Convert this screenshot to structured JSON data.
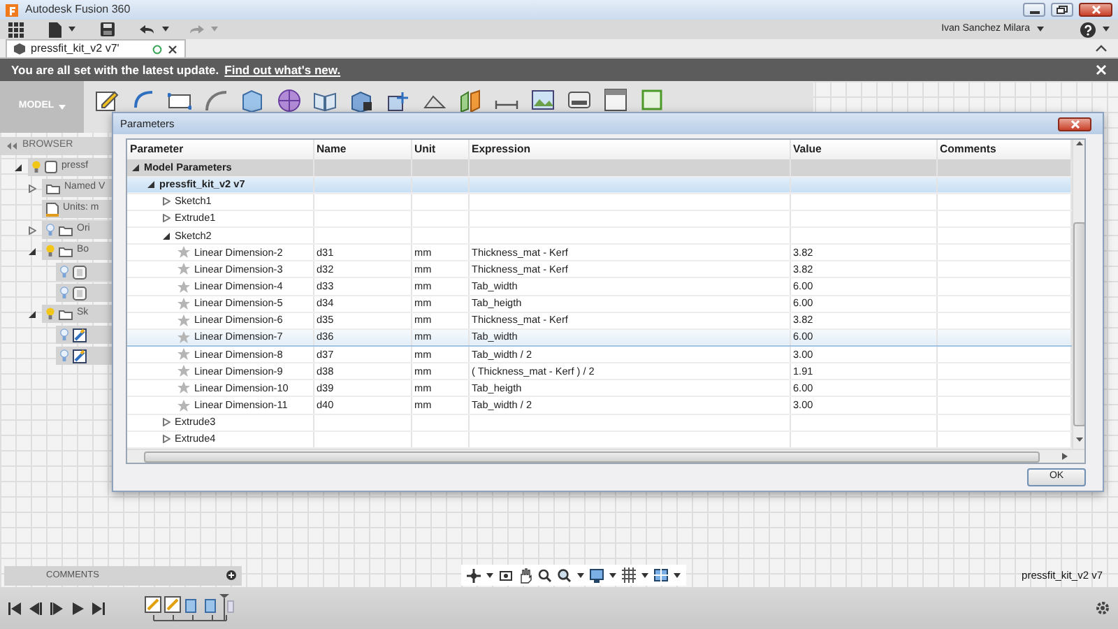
{
  "window": {
    "title": "Autodesk Fusion 360"
  },
  "toolbar": {
    "user": "Ivan Sanchez Milara"
  },
  "document_tab": {
    "title": "pressfit_kit_v2 v7'"
  },
  "banner": {
    "text": "You are all set with the latest update.",
    "link": "Find out what's new."
  },
  "ribbon": {
    "workspace": "MODEL"
  },
  "browser": {
    "title": "BROWSER",
    "items": [
      {
        "label": "pressf",
        "kind": "component",
        "expanded": true,
        "visible": true,
        "children": [
          {
            "label": "Named V",
            "kind": "folder",
            "expanded": false
          },
          {
            "label": "Units: m",
            "kind": "units"
          },
          {
            "label": "Ori",
            "kind": "folder",
            "expanded": false,
            "visible": false
          },
          {
            "label": "Bo",
            "kind": "folder",
            "expanded": true,
            "visible": true,
            "children": [
              {
                "kind": "body",
                "visible": false
              },
              {
                "kind": "body",
                "visible": false
              }
            ]
          },
          {
            "label": "Sk",
            "kind": "folder",
            "expanded": true,
            "visible": true,
            "children": [
              {
                "kind": "sketch",
                "visible": false
              },
              {
                "kind": "sketch",
                "visible": false
              }
            ]
          }
        ]
      }
    ]
  },
  "dialog": {
    "title": "Parameters",
    "columns": [
      "Parameter",
      "Name",
      "Unit",
      "Expression",
      "Value",
      "Comments"
    ],
    "rows": [
      {
        "label": "Model Parameters",
        "kind": "group",
        "expanded": true,
        "selected": false,
        "children": [
          {
            "label": "pressfit_kit_v2 v7",
            "kind": "component",
            "expanded": true,
            "selected": false,
            "children": [
              {
                "label": "Sketch1",
                "kind": "feature",
                "expanded": false,
                "selected": false
              },
              {
                "label": "Extrude1",
                "kind": "feature",
                "expanded": false,
                "selected": false
              },
              {
                "label": "Sketch2",
                "kind": "feature",
                "expanded": true,
                "selected": false,
                "children": [
                  {
                    "label": "Linear Dimension-2",
                    "kind": "parameter",
                    "name": "d31",
                    "unit": "mm",
                    "expression": "Thickness_mat - Kerf",
                    "value": "3.82",
                    "selected": false
                  },
                  {
                    "label": "Linear Dimension-3",
                    "kind": "parameter",
                    "name": "d32",
                    "unit": "mm",
                    "expression": "Thickness_mat - Kerf",
                    "value": "3.82",
                    "selected": false
                  },
                  {
                    "label": "Linear Dimension-4",
                    "kind": "parameter",
                    "name": "d33",
                    "unit": "mm",
                    "expression": "Tab_width",
                    "value": "6.00",
                    "selected": false
                  },
                  {
                    "label": "Linear Dimension-5",
                    "kind": "parameter",
                    "name": "d34",
                    "unit": "mm",
                    "expression": "Tab_heigth",
                    "value": "6.00",
                    "selected": false
                  },
                  {
                    "label": "Linear Dimension-6",
                    "kind": "parameter",
                    "name": "d35",
                    "unit": "mm",
                    "expression": "Thickness_mat - Kerf",
                    "value": "3.82",
                    "selected": false
                  },
                  {
                    "label": "Linear Dimension-7",
                    "kind": "parameter",
                    "name": "d36",
                    "unit": "mm",
                    "expression": "Tab_width",
                    "value": "6.00",
                    "selected": true
                  },
                  {
                    "label": "Linear Dimension-8",
                    "kind": "parameter",
                    "name": "d37",
                    "unit": "mm",
                    "expression": "Tab_width / 2",
                    "value": "3.00",
                    "selected": false
                  },
                  {
                    "label": "Linear Dimension-9",
                    "kind": "parameter",
                    "name": "d38",
                    "unit": "mm",
                    "expression": "( Thickness_mat - Kerf ) / 2",
                    "value": "1.91",
                    "selected": false
                  },
                  {
                    "label": "Linear Dimension-10",
                    "kind": "parameter",
                    "name": "d39",
                    "unit": "mm",
                    "expression": "Tab_heigth",
                    "value": "6.00",
                    "selected": false
                  },
                  {
                    "label": "Linear Dimension-11",
                    "kind": "parameter",
                    "name": "d40",
                    "unit": "mm",
                    "expression": "Tab_width / 2",
                    "value": "3.00",
                    "selected": false
                  }
                ]
              },
              {
                "label": "Extrude3",
                "kind": "feature",
                "expanded": false,
                "selected": false
              },
              {
                "label": "Extrude4",
                "kind": "feature",
                "expanded": false,
                "selected": false
              }
            ]
          }
        ]
      }
    ],
    "ok_button": "OK"
  },
  "comments_panel": {
    "title": "COMMENTS"
  },
  "status": {
    "document": "pressfit_kit_v2 v7"
  }
}
